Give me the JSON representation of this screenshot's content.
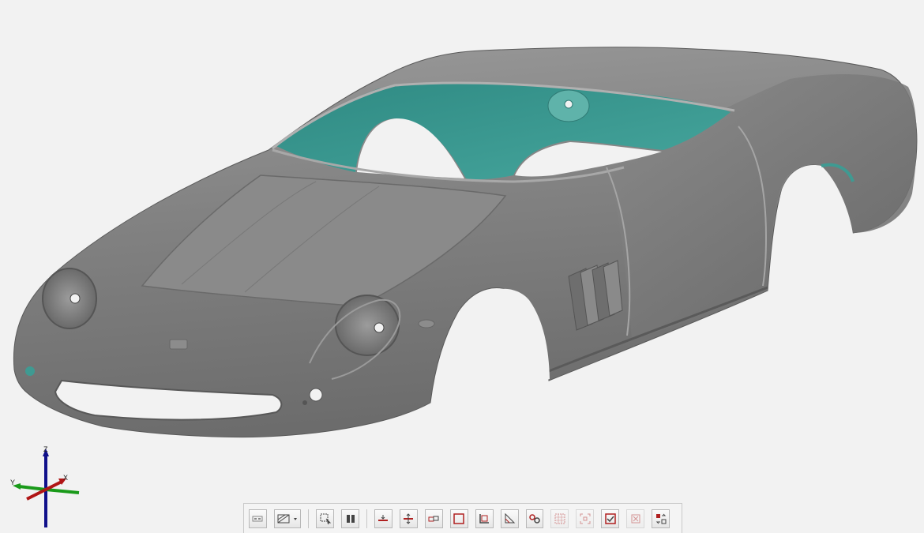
{
  "viewport": {
    "background": "#f2f2f2",
    "model_colors": {
      "body": "#7e7e7e",
      "body_shadow": "#5f5f5f",
      "body_highlight": "#a9a9a9",
      "interior": "#3f9a92",
      "interior_dark": "#2f7a74"
    }
  },
  "triad": {
    "x_label": "X",
    "y_label": "Y",
    "z_label": "Z",
    "x_color": "#b01515",
    "y_color": "#1a9a1a",
    "z_color": "#10108a"
  },
  "toolbar": {
    "accent": "#b02020",
    "buttons": [
      {
        "id": "display-mode",
        "icon": "display-mode-icon"
      },
      {
        "id": "render-style",
        "icon": "render-style-dropdown-icon"
      },
      {
        "id": "select-region",
        "icon": "select-region-icon"
      },
      {
        "id": "split-view",
        "icon": "split-view-icon"
      },
      {
        "id": "section-plane",
        "icon": "section-plane-icon"
      },
      {
        "id": "section-offset",
        "icon": "section-offset-icon"
      },
      {
        "id": "measure-distance",
        "icon": "measure-distance-icon"
      },
      {
        "id": "boundary-box",
        "icon": "boundary-box-icon"
      },
      {
        "id": "fit-boundary",
        "icon": "fit-boundary-icon"
      },
      {
        "id": "angle-measure",
        "icon": "angle-measure-icon"
      },
      {
        "id": "point-pair",
        "icon": "point-pair-icon"
      },
      {
        "id": "grid-select",
        "icon": "grid-select-icon"
      },
      {
        "id": "zoom-fit",
        "icon": "zoom-fit-icon"
      },
      {
        "id": "check-apply",
        "icon": "check-apply-icon"
      },
      {
        "id": "clear-selection",
        "icon": "clear-selection-icon"
      },
      {
        "id": "swap-transform",
        "icon": "swap-transform-icon"
      }
    ]
  }
}
